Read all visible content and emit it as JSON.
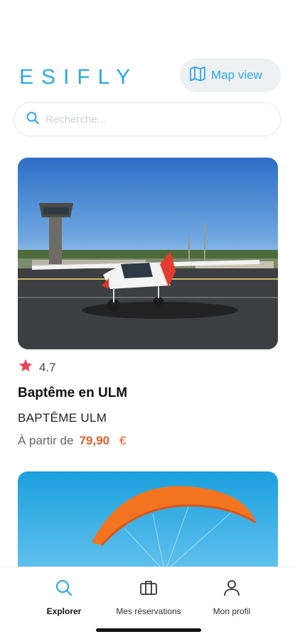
{
  "header": {
    "logo": "ESIFLY",
    "map_view_label": "Map view"
  },
  "search": {
    "placeholder": "Recherche..."
  },
  "activities": [
    {
      "rating": "4.7",
      "title": "Baptême en ULM",
      "category": "BAPTÊME ULM",
      "price_prefix": "À partir de",
      "price": "79,90",
      "currency": "€"
    }
  ],
  "tabbar": {
    "items": [
      {
        "label": "Explorer",
        "icon": "search-icon",
        "active": true
      },
      {
        "label": "Mes réservations",
        "icon": "briefcase-icon",
        "active": false
      },
      {
        "label": "Mon profil",
        "icon": "user-icon",
        "active": false
      }
    ]
  },
  "colors": {
    "brand": "#2ea7ea",
    "price": "#e2612c",
    "star": "#e9495a"
  }
}
